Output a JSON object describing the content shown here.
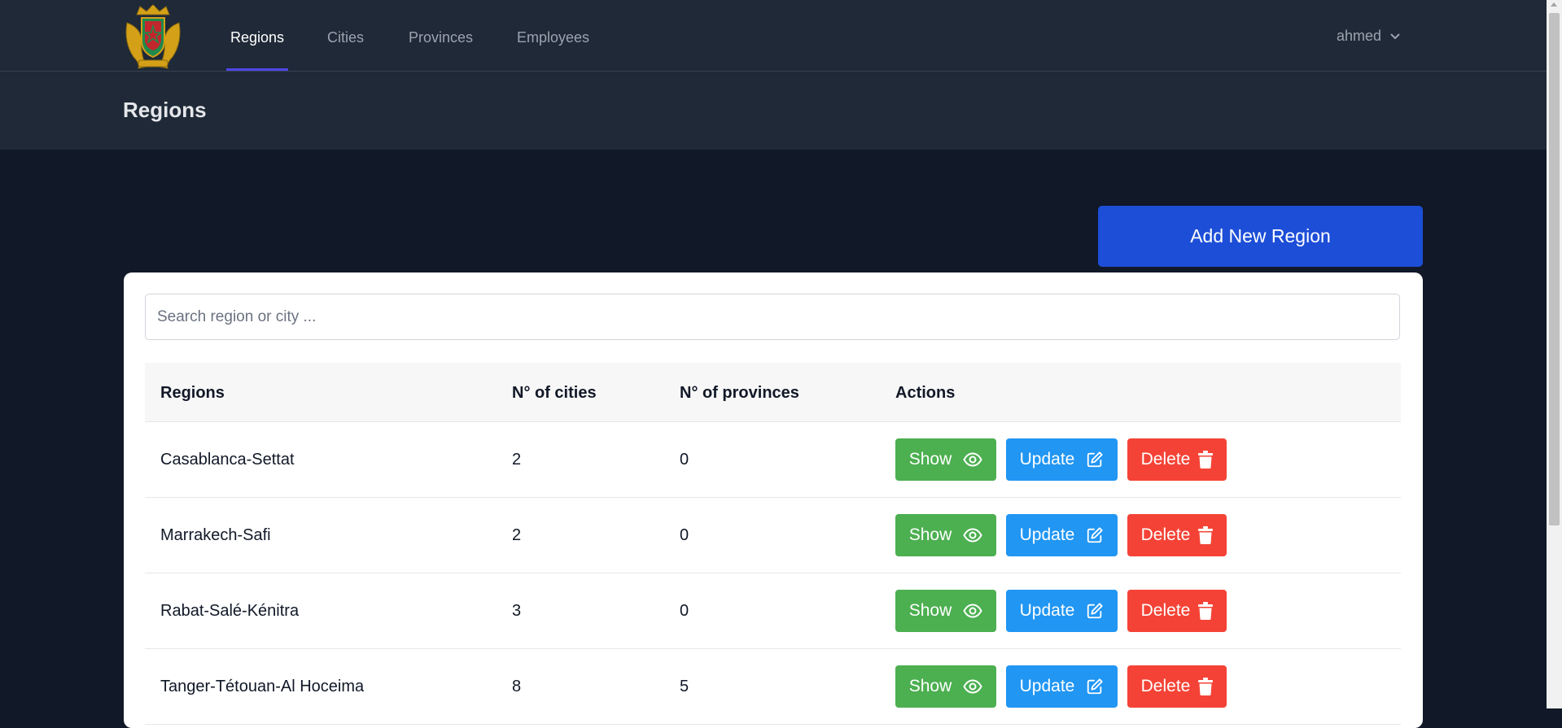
{
  "nav": {
    "links": [
      "Regions",
      "Cities",
      "Provinces",
      "Employees"
    ],
    "active": "Regions",
    "user": "ahmed"
  },
  "header": {
    "title": "Regions"
  },
  "actions": {
    "add_label": "Add New Region"
  },
  "search": {
    "placeholder": "Search region or city ..."
  },
  "table": {
    "headers": [
      "Regions",
      "N° of cities",
      "N° of provinces",
      "Actions"
    ],
    "rows": [
      {
        "region": "Casablanca-Settat",
        "cities": "2",
        "provinces": "0"
      },
      {
        "region": "Marrakech-Safi",
        "cities": "2",
        "provinces": "0"
      },
      {
        "region": "Rabat-Salé-Kénitra",
        "cities": "3",
        "provinces": "0"
      },
      {
        "region": "Tanger-Tétouan-Al Hoceima",
        "cities": "8",
        "provinces": "5"
      }
    ],
    "row_actions": {
      "show": "Show",
      "update": "Update",
      "delete": "Delete"
    }
  },
  "icons": {
    "show": "eye-icon",
    "update": "edit-icon",
    "delete": "trash-icon",
    "user_menu": "chevron-down-icon"
  },
  "colors": {
    "primary": "#1d4ed8",
    "show": "#4caf50",
    "update": "#2196f3",
    "delete": "#f44336",
    "nav_active_underline": "#4f46e5"
  }
}
